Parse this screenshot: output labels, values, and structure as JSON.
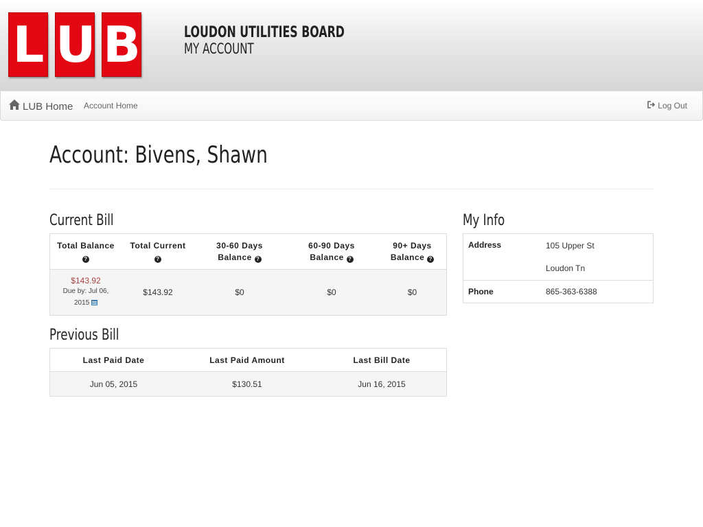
{
  "header": {
    "logo_letters": [
      "L",
      "U",
      "B"
    ],
    "org_name": "LOUDON UTILITIES BOARD",
    "sub_name": "MY ACCOUNT",
    "brand_color": "#e30613"
  },
  "navbar": {
    "brand_icon": "home-icon",
    "brand_label": "LUB Home",
    "account_home": "Account Home",
    "logout_icon": "sign-out-icon",
    "logout_label": "Log Out"
  },
  "page": {
    "title": "Account: Bivens, Shawn"
  },
  "current_bill": {
    "title": "Current Bill",
    "headers": {
      "total_balance": "Total Balance",
      "total_current": "Total Current",
      "days_30_60_line1": "30-60 Days",
      "days_30_60_line2": "Balance",
      "days_60_90_line1": "60-90 Days",
      "days_60_90_line2": "Balance",
      "days_90_line1": "90+ Days",
      "days_90_line2": "Balance"
    },
    "values": {
      "total_balance": "$143.92",
      "due_label": "Due by: Jul 06,",
      "due_year": "2015",
      "total_current": "$143.92",
      "days_30_60": "$0",
      "days_60_90": "$0",
      "days_90": "$0"
    }
  },
  "previous_bill": {
    "title": "Previous Bill",
    "headers": {
      "last_paid_date": "Last Paid Date",
      "last_paid_amount": "Last Paid Amount",
      "last_bill_date": "Last Bill Date"
    },
    "values": {
      "last_paid_date": "Jun 05, 2015",
      "last_paid_amount": "$130.51",
      "last_bill_date": "Jun 16, 2015"
    }
  },
  "my_info": {
    "title": "My Info",
    "address_label": "Address",
    "address_line1": "105 Upper St",
    "address_line2": "Loudon Tn",
    "phone_label": "Phone",
    "phone": "865-363-6388"
  },
  "colors": {
    "money": "#a94442",
    "calendar_icon": "#337ab7"
  }
}
